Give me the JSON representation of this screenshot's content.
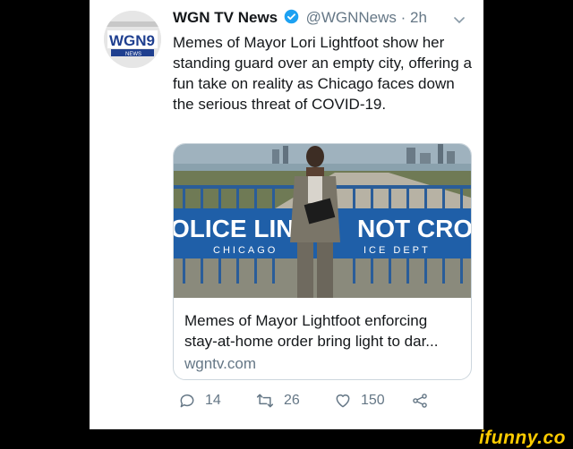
{
  "tweet": {
    "author_name": "WGN TV News",
    "handle": "@WGNNews",
    "separator": "·",
    "time": "2h",
    "text": "Memes of Mayor Lori Lightfoot show her standing guard over an empty city, offering a fun take on reality as Chicago faces down the serious threat of COVID-19.",
    "avatar_logo": "WGN9",
    "avatar_sub": "NEWS"
  },
  "link_card": {
    "image": {
      "sign_left": "OLICE LINE",
      "sign_right": "NOT CROSS",
      "sub_left": "CHICAGO",
      "sub_right": "ICE DEPT"
    },
    "title": "Memes of Mayor Lightfoot enforcing stay-at-home order bring light to dar...",
    "domain": "wgntv.com"
  },
  "actions": {
    "reply_count": "14",
    "retweet_count": "26",
    "like_count": "150"
  },
  "watermark": "ifunny.co",
  "icons": [
    "verified-icon",
    "chevron-down-icon",
    "reply-icon",
    "retweet-icon",
    "like-icon",
    "share-icon"
  ],
  "colors": {
    "verified": "#1da1f2",
    "muted": "#657786",
    "watermark": "#ffcc00",
    "sign_blue": "#1f5fa8"
  }
}
